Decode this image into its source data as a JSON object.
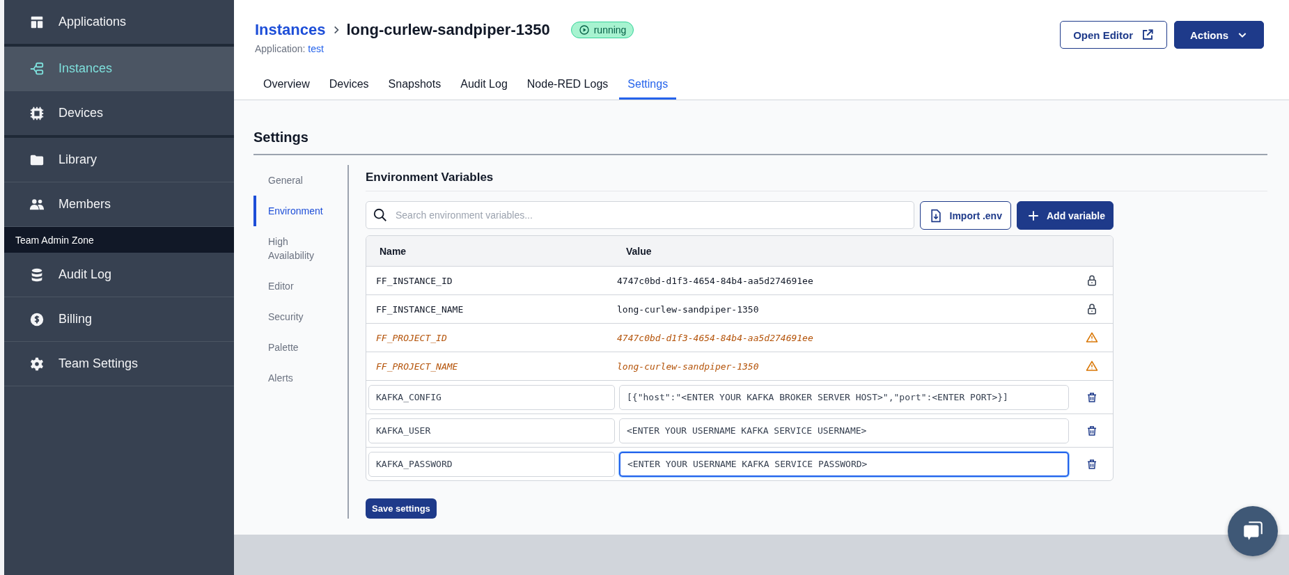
{
  "sidebar": {
    "items": [
      {
        "label": "Applications",
        "selected": false
      },
      {
        "label": "Instances",
        "selected": true
      },
      {
        "label": "Devices",
        "selected": false
      },
      {
        "label": "Library",
        "selected": false
      },
      {
        "label": "Members",
        "selected": false
      }
    ],
    "admin_zone": {
      "title": "Team Admin Zone",
      "items": [
        {
          "label": "Audit Log",
          "selected": false
        },
        {
          "label": "Billing",
          "selected": false
        },
        {
          "label": "Team Settings",
          "selected": false
        }
      ]
    }
  },
  "header": {
    "breadcrumb": "Instances",
    "title": "long-curlew-sandpiper-1350",
    "status": "running",
    "application_label": "Application:",
    "application": "test",
    "buttons": [
      {
        "label": "Open Editor",
        "kind": "outline"
      },
      {
        "label": "Actions",
        "kind": "primary"
      }
    ]
  },
  "tabs": [
    {
      "label": "Overview",
      "selected": false
    },
    {
      "label": "Devices",
      "selected": false
    },
    {
      "label": "Snapshots",
      "selected": false
    },
    {
      "label": "Audit Log",
      "selected": false
    },
    {
      "label": "Node-RED Logs",
      "selected": false
    },
    {
      "label": "Settings",
      "selected": true
    }
  ],
  "settings": {
    "title": "Settings",
    "nav": [
      {
        "label": "General",
        "selected": false
      },
      {
        "label": "Environment",
        "selected": true
      },
      {
        "label": "High Availability",
        "selected": false
      },
      {
        "label": "Editor",
        "selected": false
      },
      {
        "label": "Security",
        "selected": false
      },
      {
        "label": "Palette",
        "selected": false
      },
      {
        "label": "Alerts",
        "selected": false
      }
    ],
    "section_title": "Environment Variables",
    "search": {
      "placeholder": "Search environment variables..."
    },
    "import_button": "Import .env",
    "add_button": "Add variable",
    "table": {
      "columns": [
        "Name",
        "Value"
      ],
      "rows": [
        {
          "kind": "locked",
          "name": "FF_INSTANCE_ID",
          "value": "4747c0bd-d1f3-4654-84b4-aa5d274691ee"
        },
        {
          "kind": "locked",
          "name": "FF_INSTANCE_NAME",
          "value": "long-curlew-sandpiper-1350"
        },
        {
          "kind": "warning",
          "name": "FF_PROJECT_ID",
          "value": "4747c0bd-d1f3-4654-84b4-aa5d274691ee"
        },
        {
          "kind": "warning",
          "name": "FF_PROJECT_NAME",
          "value": "long-curlew-sandpiper-1350"
        },
        {
          "kind": "editable",
          "name": "KAFKA_CONFIG",
          "value": "[{\"host\":\"<ENTER YOUR KAFKA BROKER SERVER HOST>\",\"port\":<ENTER PORT>}]",
          "focused": false
        },
        {
          "kind": "editable",
          "name": "KAFKA_USER",
          "value": "<ENTER YOUR USERNAME KAFKA SERVICE USERNAME>",
          "focused": false
        },
        {
          "kind": "editable",
          "name": "KAFKA_PASSWORD",
          "value": "<ENTER YOUR USERNAME KAFKA SERVICE PASSWORD>",
          "focused": true
        }
      ]
    },
    "save_button": "Save settings"
  }
}
